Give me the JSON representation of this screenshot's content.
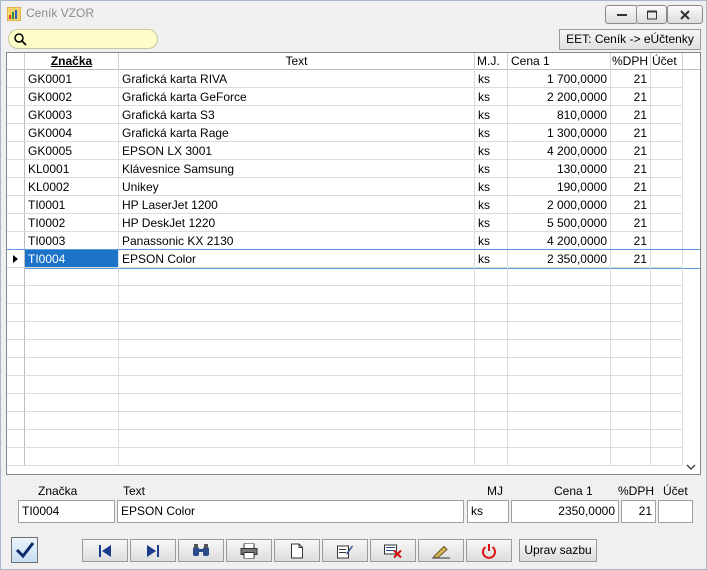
{
  "window": {
    "title": "Ceník VZOR"
  },
  "toolbar_top": {
    "eet_label": "EET: Ceník -> eÚčtenky"
  },
  "grid": {
    "columns": [
      "Značka",
      "Text",
      "M.J.",
      "Cena 1",
      "%DPH",
      "Účet"
    ],
    "rows": [
      [
        "GK0001",
        "Grafická karta RIVA",
        "ks",
        "1 700,0000",
        "21",
        ""
      ],
      [
        "GK0002",
        "Grafická karta GeForce",
        "ks",
        "2 200,0000",
        "21",
        ""
      ],
      [
        "GK0003",
        "Grafická karta S3",
        "ks",
        "810,0000",
        "21",
        ""
      ],
      [
        "GK0004",
        "Grafická karta Rage",
        "ks",
        "1 300,0000",
        "21",
        ""
      ],
      [
        "GK0005",
        "EPSON LX 3001",
        "ks",
        "4 200,0000",
        "21",
        ""
      ],
      [
        "KL0001",
        "Klávesnice Samsung",
        "ks",
        "130,0000",
        "21",
        ""
      ],
      [
        "KL0002",
        "Unikey",
        "ks",
        "190,0000",
        "21",
        ""
      ],
      [
        "TI0001",
        "HP LaserJet 1200",
        "ks",
        "2 000,0000",
        "21",
        ""
      ],
      [
        "TI0002",
        "HP DeskJet 1220",
        "ks",
        "5 500,0000",
        "21",
        ""
      ],
      [
        "TI0003",
        "Panassonic KX 2130",
        "ks",
        "4 200,0000",
        "21",
        ""
      ],
      [
        "TI0004",
        "EPSON Color",
        "ks",
        "2 350,0000",
        "21",
        ""
      ]
    ],
    "selected_row": 10
  },
  "detail": {
    "labels": {
      "znacka": "Značka",
      "text": "Text",
      "mj": "MJ",
      "cena": "Cena 1",
      "dph": "%DPH",
      "ucet": "Účet"
    },
    "values": {
      "znacka": "TI0004",
      "text": "EPSON Color",
      "mj": "ks",
      "cena": "2350,0000",
      "dph": "21",
      "ucet": ""
    }
  },
  "bottom_toolbar": {
    "icons": [
      "first-record-icon",
      "last-record-icon",
      "find-icon",
      "print-icon",
      "new-document-icon",
      "edit-icon",
      "delete-icon",
      "tools-icon",
      "power-icon"
    ],
    "uprav_label": "Uprav sazbu"
  }
}
